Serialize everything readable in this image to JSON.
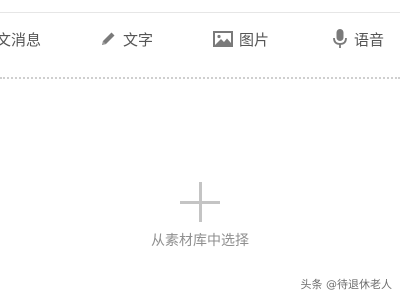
{
  "tabs": {
    "appmsg_label": "文消息",
    "text_label": "文字",
    "image_label": "图片",
    "voice_label": "语音"
  },
  "picker": {
    "label": "从素材库中选择"
  },
  "watermark": {
    "text": "头条 @待退休老人"
  },
  "icons": {
    "text": "pencil-icon",
    "image": "image-icon",
    "voice": "microphone-icon",
    "picker": "plus-icon"
  },
  "colors": {
    "tab_text": "#555555",
    "icon": "#7a7a7a",
    "plus": "#c4c4c4",
    "label": "#8f8f8f"
  }
}
